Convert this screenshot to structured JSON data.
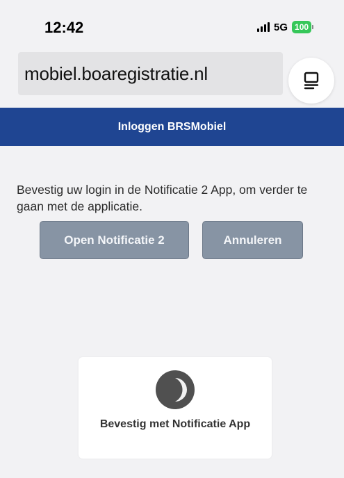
{
  "status_bar": {
    "time": "12:42",
    "network": "5G",
    "battery": "100",
    "icons": [
      "signal-icon",
      "battery-icon"
    ]
  },
  "browser": {
    "url": "mobiel.boaregistratie.nl",
    "reader_icon": "reader-mode-icon"
  },
  "header": {
    "title": "Inloggen BRSMobiel",
    "color": "#1f4592"
  },
  "main": {
    "message": "Bevestig uw login in de Notificatie 2 App, om verder te gaan met de applicatie.",
    "open_button": "Open Notificatie 2",
    "cancel_button": "Annuleren",
    "button_color": "#8794a4"
  },
  "confirm": {
    "icon": "loading-spinner-icon",
    "text": "Bevestig met Notificatie App"
  }
}
